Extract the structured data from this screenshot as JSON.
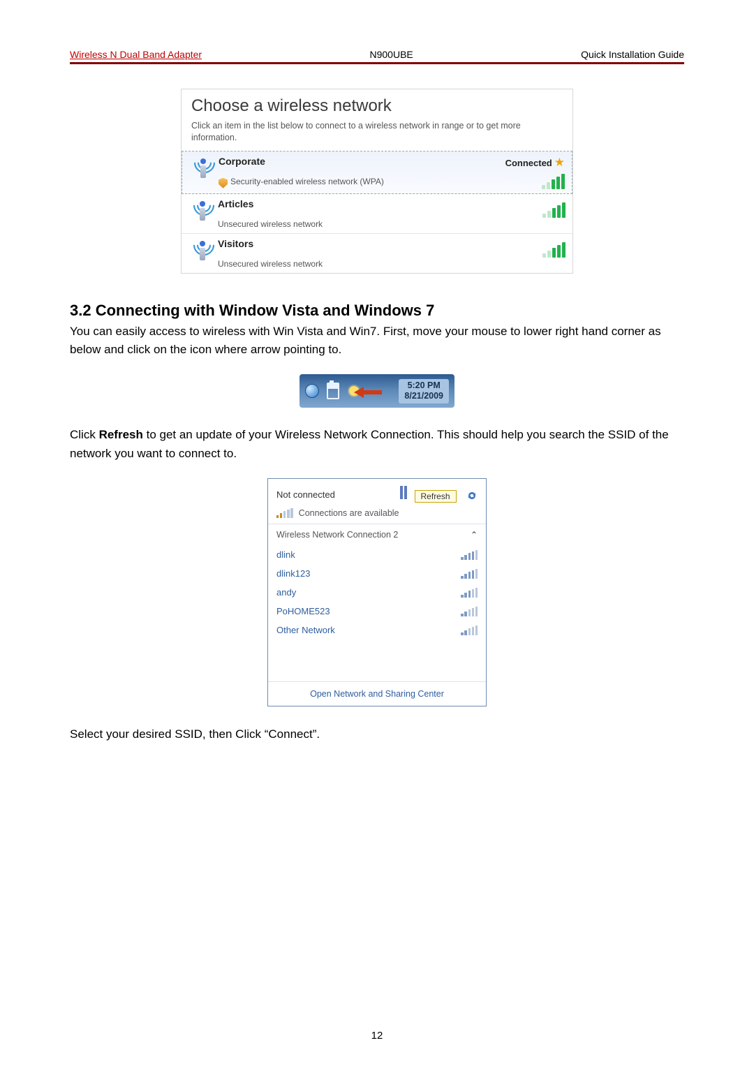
{
  "header": {
    "left": "Wireless N Dual Band Adapter",
    "center": "N900UBE",
    "right": "Quick Installation Guide"
  },
  "fig_xp": {
    "title": "Choose a wireless network",
    "subtitle": "Click an item in the list below to connect to a wireless network in range or to get more information.",
    "networks": [
      {
        "name": "Corporate",
        "desc": "Security-enabled wireless network (WPA)",
        "status": "Connected",
        "secure": true,
        "selected": true
      },
      {
        "name": "Articles",
        "desc": "Unsecured wireless network",
        "status": "",
        "secure": false,
        "selected": false
      },
      {
        "name": "Visitors",
        "desc": "Unsecured wireless network",
        "status": "",
        "secure": false,
        "selected": false
      }
    ]
  },
  "section": {
    "heading": "3.2 Connecting with Window Vista and Windows 7",
    "para1": "You can easily access to wireless with Win Vista and Win7. First, move your mouse to lower right hand corner as below and click on the icon where arrow pointing to.",
    "para2a": "Click ",
    "para2_bold": "Refresh",
    "para2b": " to get an update of your Wireless Network Connection. This should help you search the SSID of the network you want to connect to.",
    "para3": "Select your desired SSID, then Click “Connect”."
  },
  "tray": {
    "time": "5:20 PM",
    "date": "8/21/2009"
  },
  "flyout": {
    "not_connected": "Not connected",
    "refresh": "Refresh",
    "available": "Connections are available",
    "section": "Wireless Network Connection 2",
    "ssids": [
      "dlink",
      "dlink123",
      "andy",
      "PoHOME523",
      "Other Network"
    ],
    "footer": "Open Network and Sharing Center"
  },
  "page_number": "12"
}
